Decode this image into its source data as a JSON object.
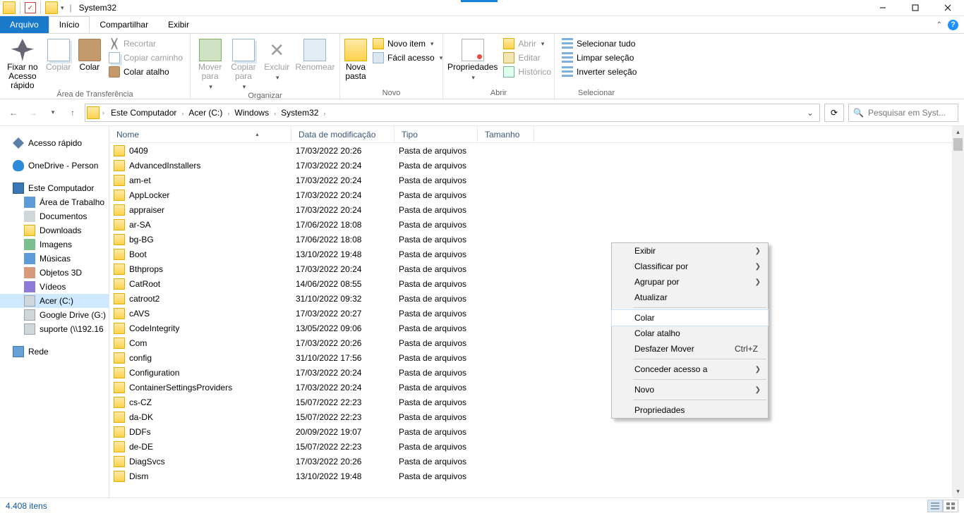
{
  "window": {
    "title": "System32"
  },
  "tabs": {
    "file": "Arquivo",
    "home": "Início",
    "share": "Compartilhar",
    "view": "Exibir"
  },
  "ribbon": {
    "clipboard": {
      "group": "Área de Transferência",
      "pin": "Fixar no\nAcesso rápido",
      "copy": "Copiar",
      "paste": "Colar",
      "cut": "Recortar",
      "copypath": "Copiar caminho",
      "pasteshortcut": "Colar atalho"
    },
    "organize": {
      "group": "Organizar",
      "moveto": "Mover\npara",
      "copyto": "Copiar\npara",
      "delete": "Excluir",
      "rename": "Renomear"
    },
    "new": {
      "group": "Novo",
      "newfolder": "Nova\npasta",
      "newitem": "Novo item",
      "easyaccess": "Fácil acesso"
    },
    "open": {
      "group": "Abrir",
      "properties": "Propriedades",
      "open": "Abrir",
      "edit": "Editar",
      "history": "Histórico"
    },
    "select": {
      "group": "Selecionar",
      "selectall": "Selecionar tudo",
      "selectnone": "Limpar seleção",
      "invert": "Inverter seleção"
    }
  },
  "breadcrumbs": [
    "Este Computador",
    "Acer (C:)",
    "Windows",
    "System32"
  ],
  "search": {
    "placeholder": "Pesquisar em Syst..."
  },
  "tree": {
    "quick": "Acesso rápido",
    "onedrive": "OneDrive - Person",
    "thispc": "Este Computador",
    "children": [
      {
        "icon": "ti-desk",
        "label": "Área de Trabalho"
      },
      {
        "icon": "ti-doc",
        "label": "Documentos"
      },
      {
        "icon": "ti-folder",
        "label": "Downloads"
      },
      {
        "icon": "ti-img",
        "label": "Imagens"
      },
      {
        "icon": "ti-music",
        "label": "Músicas"
      },
      {
        "icon": "ti-3d",
        "label": "Objetos 3D"
      },
      {
        "icon": "ti-vid",
        "label": "Vídeos"
      },
      {
        "icon": "ti-drive",
        "label": "Acer (C:)",
        "selected": true
      },
      {
        "icon": "ti-drive",
        "label": "Google Drive (G:)"
      },
      {
        "icon": "ti-drive",
        "label": "suporte (\\\\192.16"
      }
    ],
    "network": "Rede"
  },
  "columns": {
    "name": "Nome",
    "date": "Data de modificação",
    "type": "Tipo",
    "size": "Tamanho"
  },
  "type_folder": "Pasta de arquivos",
  "rows": [
    {
      "name": "0409",
      "date": "17/03/2022 20:26"
    },
    {
      "name": "AdvancedInstallers",
      "date": "17/03/2022 20:24"
    },
    {
      "name": "am-et",
      "date": "17/03/2022 20:24"
    },
    {
      "name": "AppLocker",
      "date": "17/03/2022 20:24"
    },
    {
      "name": "appraiser",
      "date": "17/03/2022 20:24"
    },
    {
      "name": "ar-SA",
      "date": "17/06/2022 18:08"
    },
    {
      "name": "bg-BG",
      "date": "17/06/2022 18:08"
    },
    {
      "name": "Boot",
      "date": "13/10/2022 19:48"
    },
    {
      "name": "Bthprops",
      "date": "17/03/2022 20:24"
    },
    {
      "name": "CatRoot",
      "date": "14/06/2022 08:55"
    },
    {
      "name": "catroot2",
      "date": "31/10/2022 09:32"
    },
    {
      "name": "cAVS",
      "date": "17/03/2022 20:27"
    },
    {
      "name": "CodeIntegrity",
      "date": "13/05/2022 09:06"
    },
    {
      "name": "Com",
      "date": "17/03/2022 20:26"
    },
    {
      "name": "config",
      "date": "31/10/2022 17:56"
    },
    {
      "name": "Configuration",
      "date": "17/03/2022 20:24"
    },
    {
      "name": "ContainerSettingsProviders",
      "date": "17/03/2022 20:24"
    },
    {
      "name": "cs-CZ",
      "date": "15/07/2022 22:23"
    },
    {
      "name": "da-DK",
      "date": "15/07/2022 22:23"
    },
    {
      "name": "DDFs",
      "date": "20/09/2022 19:07"
    },
    {
      "name": "de-DE",
      "date": "15/07/2022 22:23"
    },
    {
      "name": "DiagSvcs",
      "date": "17/03/2022 20:26"
    },
    {
      "name": "Dism",
      "date": "13/10/2022 19:48"
    }
  ],
  "context_menu": [
    {
      "label": "Exibir",
      "submenu": true
    },
    {
      "label": "Classificar por",
      "submenu": true
    },
    {
      "label": "Agrupar por",
      "submenu": true
    },
    {
      "label": "Atualizar"
    },
    {
      "sep": true
    },
    {
      "label": "Colar",
      "hover": true
    },
    {
      "label": "Colar atalho"
    },
    {
      "label": "Desfazer Mover",
      "shortcut": "Ctrl+Z"
    },
    {
      "sep": true
    },
    {
      "label": "Conceder acesso a",
      "submenu": true
    },
    {
      "sep": true
    },
    {
      "label": "Novo",
      "submenu": true
    },
    {
      "sep": true
    },
    {
      "label": "Propriedades"
    }
  ],
  "status": {
    "count": "4.408 itens"
  }
}
